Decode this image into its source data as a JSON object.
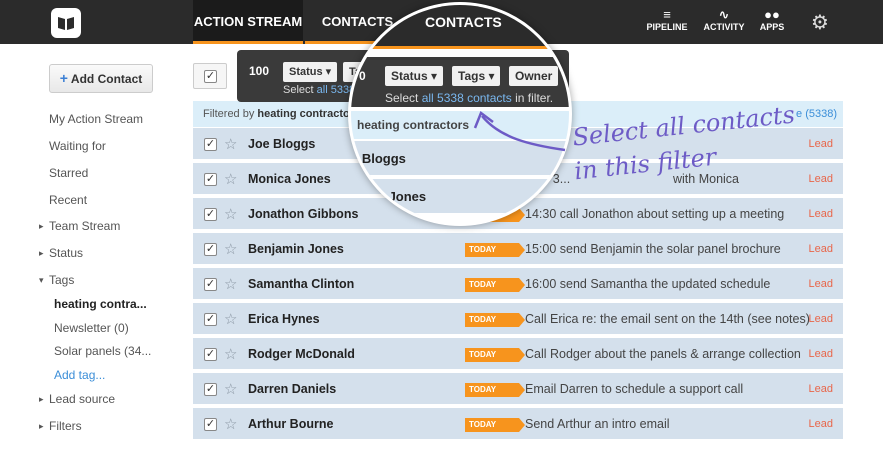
{
  "topnav": {
    "tabs": [
      "ACTION STREAM",
      "CONTACTS"
    ],
    "icons": [
      {
        "label": "PIPELINE",
        "icon": "filter-icon"
      },
      {
        "label": "ACTIVITY",
        "icon": "pulse-icon"
      },
      {
        "label": "APPS",
        "icon": "apps-icon"
      }
    ],
    "settings_icon": "gear-icon"
  },
  "sidebar": {
    "add_contact": "Add Contact",
    "items": [
      "My Action Stream",
      "Waiting for",
      "Starred",
      "Recent"
    ],
    "team_stream": "Team Stream",
    "status": "Status",
    "tags": "Tags",
    "tag_items": [
      "heating contra...",
      "Newsletter (0)",
      "Solar panels (34..."
    ],
    "add_tag": "Add tag...",
    "lead_source": "Lead source",
    "filters": "Filters"
  },
  "filter_bar": {
    "prefix": "Filtered by",
    "tag": "heating contractors",
    "count": "e (5338)"
  },
  "popup": {
    "count": "100",
    "status": "Status",
    "tags": "Ta",
    "select_prefix": "Select",
    "select_link": "all 5338"
  },
  "magnifier": {
    "title": "CONTACTS",
    "zero": "0",
    "status": "Status",
    "tags": "Tags",
    "owner": "Owner",
    "select_prefix": "Select",
    "select_link": "all 5338 contacts",
    "select_suffix": "in filter.",
    "filter_tag": "heating contractors",
    "row1": "e Bloggs",
    "row2": "onica Jones"
  },
  "annotation": {
    "line1": "Select all contacts",
    "line2": "in this filter"
  },
  "today_label": "TODAY",
  "lead_label": "Lead",
  "rows": [
    {
      "name": "Joe Bloggs",
      "today": false,
      "task": ""
    },
    {
      "name": "Monica Jones",
      "today": false,
      "task": "5:00 3..."
    },
    {
      "name": "Jonathon Gibbons",
      "today": true,
      "task": "14:30 call Jonathon about setting up a meeting"
    },
    {
      "name": "Benjamin Jones",
      "today": true,
      "task": "15:00 send Benjamin the solar panel brochure"
    },
    {
      "name": "Samantha Clinton",
      "today": true,
      "task": "16:00 send Samantha the updated schedule"
    },
    {
      "name": "Erica Hynes",
      "today": true,
      "task": "Call Erica re: the email sent on the 14th (see notes)"
    },
    {
      "name": "Rodger McDonald",
      "today": true,
      "task": "Call Rodger about the panels & arrange collection"
    },
    {
      "name": "Darren Daniels",
      "today": true,
      "task": "Email Darren to schedule a support call"
    },
    {
      "name": "Arthur Bourne",
      "today": true,
      "task": "Send Arthur an intro email"
    }
  ],
  "monica_tail": "with Monica",
  "colors": {
    "accent": "#f7941d",
    "topbar": "#2b2b2b",
    "row": "#d4e0ec",
    "link": "#3b8ed8",
    "lead": "#e8664a"
  }
}
